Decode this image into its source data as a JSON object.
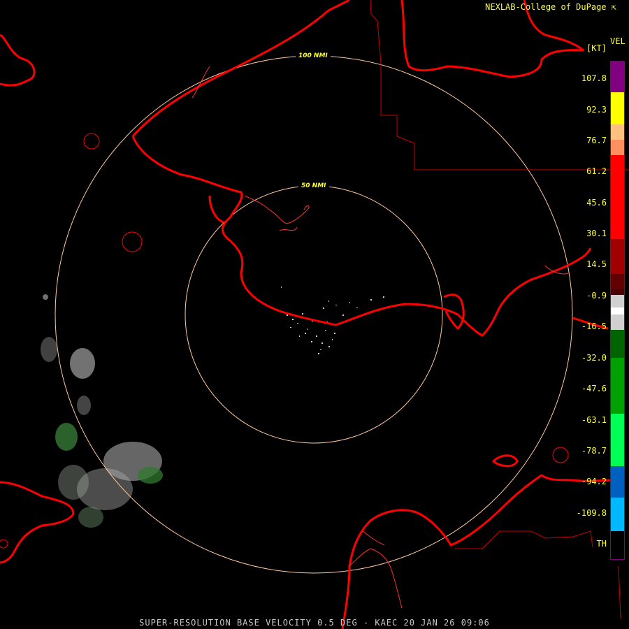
{
  "header": {
    "credit": "NEXLAB-College of DuPage",
    "credit_icon": "arrow-cursor-icon"
  },
  "colorbar": {
    "product": "VEL",
    "unit": "[KT]",
    "labels": [
      "107.8",
      "92.3",
      "76.7",
      "61.2",
      "45.6",
      "30.1",
      "14.5",
      "-0.9",
      "-16.5",
      "-32.0",
      "-47.6",
      "-63.1",
      "-78.7",
      "-94.2",
      "-109.8",
      "TH"
    ]
  },
  "rings": {
    "inner_label": "50 NMI",
    "outer_label": "100 NMI"
  },
  "footer": {
    "caption": "SUPER-RESOLUTION BASE VELOCITY 0.5 DEG - KAEC 20 JAN 26 09:06"
  },
  "colors": {
    "coastline": "#ff0000",
    "boundary": "#cc0000",
    "range_ring": "#ffc8a0",
    "text": "#ffff33",
    "outbound_scale": [
      "#800080",
      "#ffff00",
      "#ffa070",
      "#ff0000",
      "#800000"
    ],
    "inbound_scale": [
      "#006400",
      "#00c800",
      "#00ff66",
      "#0064c8",
      "#00c8ff"
    ]
  }
}
